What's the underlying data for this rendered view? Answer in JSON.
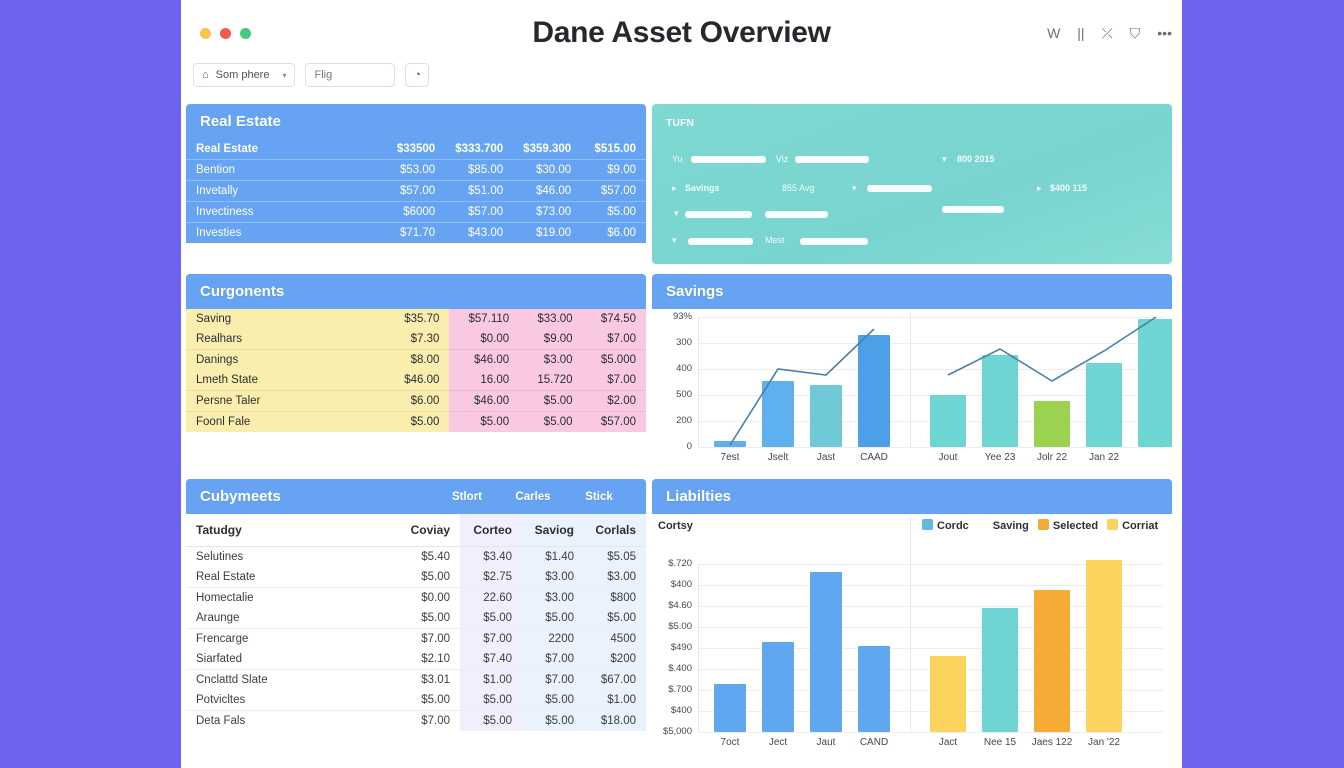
{
  "window": {
    "title": "Dane Asset Overview",
    "traffic_lights": [
      "yellow",
      "red",
      "green"
    ],
    "icons": [
      {
        "name": "w-icon",
        "glyph": "W"
      },
      {
        "name": "pause-icon",
        "glyph": "||"
      },
      {
        "name": "shuffle-icon",
        "glyph": "⤫"
      },
      {
        "name": "bag-icon",
        "glyph": "⛉"
      },
      {
        "name": "more-icon",
        "glyph": "•••"
      }
    ]
  },
  "toolbar": {
    "select_label": "Som phere",
    "select_icon": "⌂",
    "chevron": "▾",
    "input_value": "Flig",
    "input_placeholder": "Flig",
    "button_icon": "◔"
  },
  "real_estate": {
    "title": "Real Estate",
    "rows": [
      {
        "label": "Real Estate",
        "values": [
          "$33500",
          "$333.700",
          "$359.300",
          "$515.00"
        ]
      },
      {
        "label": "Bention",
        "values": [
          "$53.00",
          "$85.00",
          "$30.00",
          "$9.00"
        ]
      },
      {
        "label": "Invetally",
        "values": [
          "$57.00",
          "$51.00",
          "$46.00",
          "$57.00"
        ]
      },
      {
        "label": "Invectiness",
        "values": [
          "$6000",
          "$57.00",
          "$73.00",
          "$5.00"
        ]
      },
      {
        "label": "Investies",
        "values": [
          "$71.70",
          "$43.00",
          "$19.00",
          "$6.00"
        ]
      }
    ]
  },
  "teal_panel": {
    "title": "TUFN",
    "labels": [
      "Yu",
      "Viz",
      "Savings",
      "855 Avg",
      "Mest"
    ],
    "values": [
      "800 2015",
      "$400 115"
    ],
    "markers": [
      "▾",
      "▸",
      "▾",
      "▾",
      "▾",
      "▸",
      "▾"
    ]
  },
  "components": {
    "title": "Curgonents",
    "rows": [
      {
        "label": "Saving",
        "values": [
          "$35.70",
          "$57.110",
          "$33.00",
          "$74.50"
        ],
        "group": 0
      },
      {
        "label": "Realhars",
        "values": [
          "$7.30",
          "$0.00",
          "$9.00",
          "$7.00"
        ],
        "group": 0
      },
      {
        "label": "Danings",
        "values": [
          "$8.00",
          "$46.00",
          "$3.00",
          "$5.000"
        ],
        "group": 1
      },
      {
        "label": "Lmeth State",
        "values": [
          "$46.00",
          "16.00",
          "15.720",
          "$7.00"
        ],
        "group": 1
      },
      {
        "label": "Persne Taler",
        "values": [
          "$6.00",
          "$46.00",
          "$5.00",
          "$2.00"
        ],
        "group": 2
      },
      {
        "label": "Foonl Fale",
        "values": [
          "$5.00",
          "$5.00",
          "$5.00",
          "$57.00"
        ],
        "group": 3
      }
    ]
  },
  "cubymeets": {
    "title": "Cubymeets",
    "head_extra": [
      "Stlort",
      "Carles",
      "Stick"
    ],
    "columns": [
      "Tatudgy",
      "Coviay",
      "Corteo",
      "Saviog",
      "Corlals"
    ],
    "rows": [
      {
        "label": "Selutines",
        "values": [
          "$5.40",
          "$3.40",
          "$1.40",
          "$5.05"
        ],
        "group": 0
      },
      {
        "label": "Real Estate",
        "values": [
          "$5.00",
          "$2.75",
          "$3.00",
          "$3.00"
        ],
        "group": 0
      },
      {
        "label": "Homectalie",
        "values": [
          "$0.00",
          "22.60",
          "$3.00",
          "$800"
        ],
        "group": 1
      },
      {
        "label": "Araunge",
        "values": [
          "$5.00",
          "$5.00",
          "$5.00",
          "$5.00"
        ],
        "group": 1
      },
      {
        "label": "Frencarge",
        "values": [
          "$7.00",
          "$7.00",
          "2200",
          "4500"
        ],
        "group": 2
      },
      {
        "label": "Siarfated",
        "values": [
          "$2.10",
          "$7.40",
          "$7.00",
          "$200"
        ],
        "group": 2
      },
      {
        "label": "Cnclattd Slate",
        "values": [
          "$3.01",
          "$1.00",
          "$7.00",
          "$67.00"
        ],
        "group": 3
      },
      {
        "label": "Potvicltes",
        "values": [
          "$5.00",
          "$5.00",
          "$5.00",
          "$1.00"
        ],
        "group": 3
      },
      {
        "label": "Deta Fals",
        "values": [
          "$7.00",
          "$5.00",
          "$5.00",
          "$18.00"
        ],
        "group": 4
      }
    ]
  },
  "chart_data": [
    {
      "id": "savings",
      "type": "bar",
      "title": "Savings",
      "ylabel": "",
      "xlabel": "",
      "grid": true,
      "legend": "none",
      "ytick_labels": [
        "93%",
        "300",
        "400",
        "500",
        "200",
        "0"
      ],
      "panels": [
        {
          "categories": [
            "7est",
            "Jselt",
            "Jast",
            "CAAD"
          ],
          "series": [
            {
              "name": "bars",
              "values": [
                6,
                66,
                62,
                112
              ],
              "colors": [
                "#5fb0ee",
                "#5fb0ee",
                "#6fc9d6",
                "#4d9fe8"
              ]
            },
            {
              "name": "trend",
              "values": [
                2,
                78,
                72,
                118
              ],
              "color": "#4b7fa8",
              "type": "line"
            }
          ]
        },
        {
          "categories": [
            "Jout",
            "Yee 23",
            "Jolr 22",
            "Jan 22"
          ],
          "series": [
            {
              "name": "bars",
              "values": [
                52,
                92,
                46,
                84,
                128
              ],
              "colors": [
                "#6fd5d2",
                "#6fd5d2",
                "#9bd250",
                "#6fd5d2",
                "#6fd5d2"
              ]
            },
            {
              "name": "trend",
              "values": [
                72,
                98,
                66,
                96,
                130
              ],
              "color": "#4b7fa8",
              "type": "line"
            }
          ]
        }
      ]
    },
    {
      "id": "liabilities",
      "type": "bar",
      "title": "Liabilties",
      "ylabel": "Cortsy",
      "xlabel": "",
      "grid": true,
      "legend": "top-right",
      "legend_items": [
        {
          "label": "Cordc",
          "color": "#62b9e0"
        },
        {
          "label": "Saving",
          "color": "transparent"
        },
        {
          "label": "Selected",
          "color": "#f5ab35"
        },
        {
          "label": "Corriat",
          "color": "#fad25c"
        }
      ],
      "ytick_labels": [
        "$.720",
        "$400",
        "$4.60",
        "$5.00",
        "$490",
        "$.400",
        "$.700",
        "$400",
        "$5,000"
      ],
      "panels": [
        {
          "categories": [
            "7oct",
            "Ject",
            "Jaut",
            "CAND"
          ],
          "series": [
            {
              "name": "bars",
              "values": [
                48,
                90,
                160,
                86
              ],
              "colors": [
                "#5fa8f0",
                "#5fa8f0",
                "#5fa8f0",
                "#5fa8f0"
              ]
            }
          ]
        },
        {
          "categories": [
            "Jact",
            "Nee 15",
            "Jaes 122",
            "Jan '22"
          ],
          "series": [
            {
              "name": "bars",
              "values": [
                76,
                124,
                142,
                172
              ],
              "colors": [
                "#fad25c",
                "#6fd5d2",
                "#f5ab35",
                "#fad25c"
              ]
            }
          ]
        }
      ]
    }
  ]
}
